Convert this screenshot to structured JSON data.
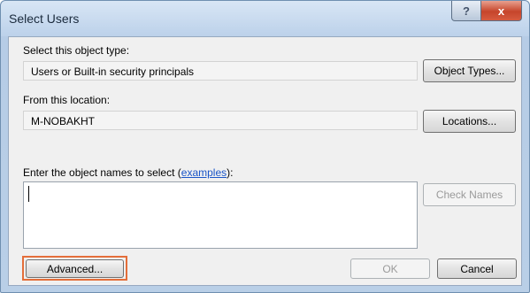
{
  "window": {
    "title": "Select Users",
    "help_label": "?",
    "close_label": "x"
  },
  "object_type": {
    "label": "Select this object type:",
    "value": "Users or Built-in security principals",
    "button_label": "Object Types..."
  },
  "location": {
    "label": "From this location:",
    "value": "M-NOBAKHT",
    "button_label": "Locations..."
  },
  "names": {
    "label_prefix": "Enter the object names to select (",
    "label_link": "examples",
    "label_suffix": "):",
    "value": "",
    "check_button_label": "Check Names"
  },
  "footer": {
    "advanced_label": "Advanced...",
    "ok_label": "OK",
    "cancel_label": "Cancel"
  },
  "colors": {
    "highlight": "#e46e3a",
    "link": "#1a55c8"
  }
}
